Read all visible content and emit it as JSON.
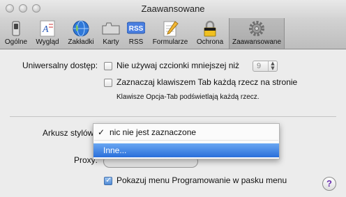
{
  "window": {
    "title": "Zaawansowane"
  },
  "toolbar": {
    "items": [
      {
        "label": "Ogólne",
        "icon": "switch-icon"
      },
      {
        "label": "Wygląd",
        "icon": "font-icon"
      },
      {
        "label": "Zakładki",
        "icon": "globe-icon"
      },
      {
        "label": "Karty",
        "icon": "tabs-icon"
      },
      {
        "label": "RSS",
        "icon": "rss-icon",
        "icon_text": "RSS"
      },
      {
        "label": "Formularze",
        "icon": "pencil-form-icon"
      },
      {
        "label": "Ochrona",
        "icon": "lock-icon"
      },
      {
        "label": "Zaawansowane",
        "icon": "gear-icon",
        "selected": true
      }
    ]
  },
  "accessibility": {
    "label": "Uniwersalny dostęp:",
    "min_font_checkbox": {
      "label": "Nie używaj czcionki mniejszej niż",
      "checked": false
    },
    "min_font_select": {
      "value": "9"
    },
    "tab_checkbox": {
      "label": "Zaznaczaj klawiszem Tab każdą rzecz na stronie",
      "checked": false
    },
    "tab_hint": "Klawisze Opcja-Tab podświetlają każdą rzecz."
  },
  "stylesheet": {
    "label": "Arkusz stylów:",
    "menu": {
      "check_mark": "✓",
      "selected_option": "nic nie jest zaznaczone",
      "highlighted_option": "Inne..."
    }
  },
  "proxy": {
    "label": "Proxy:"
  },
  "develop_menu_checkbox": {
    "label": "Pokazuj menu Programowanie w pasku menu",
    "checked": true
  },
  "help": {
    "glyph": "?"
  },
  "colors": {
    "menu_highlight": "#2a6fda",
    "help_glyph": "#6a2fb0"
  }
}
